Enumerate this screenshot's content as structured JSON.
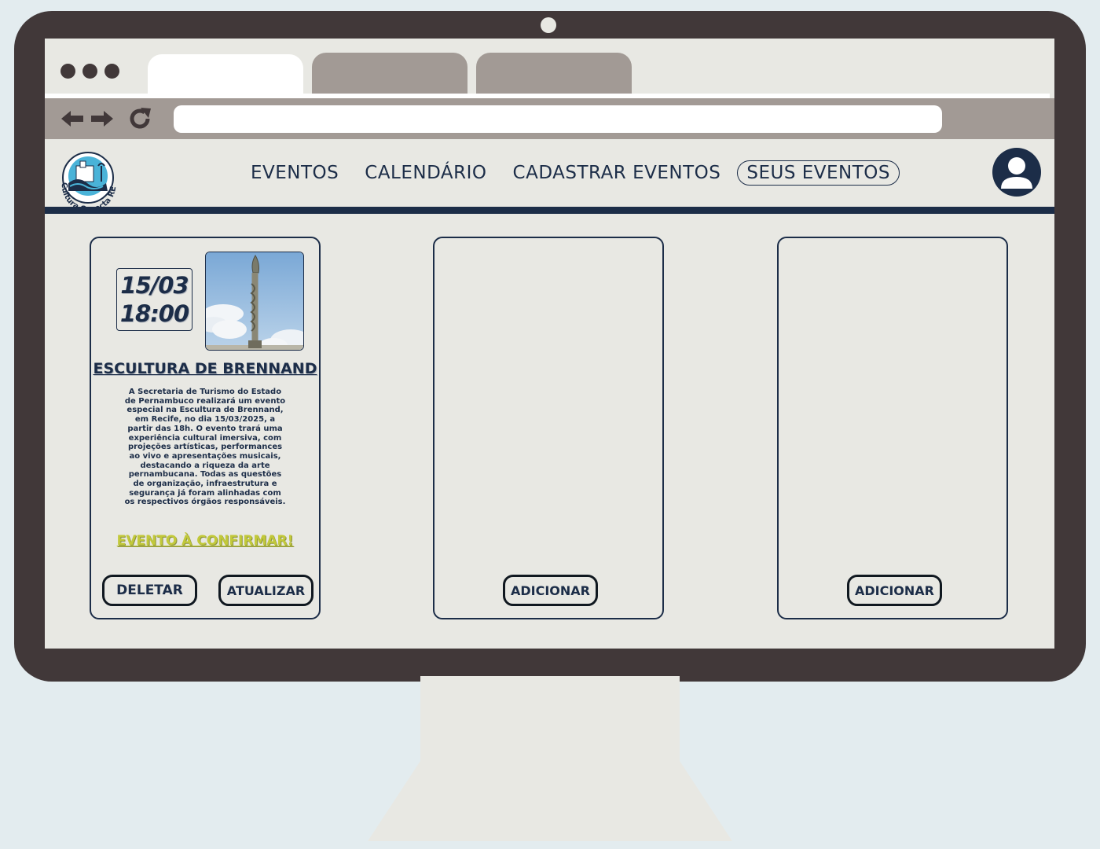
{
  "browser": {
    "tabs": [
      {
        "label": ""
      },
      {
        "label": ""
      },
      {
        "label": ""
      }
    ],
    "address": {
      "value": ""
    }
  },
  "site": {
    "logo_text": "Cultura Conecta REC",
    "nav": [
      {
        "label": "EVENTOS"
      },
      {
        "label": "CALENDÁRIO"
      },
      {
        "label": "CADASTRAR EVENTOS"
      },
      {
        "label": "SEUS EVENTOS",
        "current": true
      }
    ]
  },
  "events": [
    {
      "date": "15/03",
      "time": "18:00",
      "title": "ESCULTURA DE BRENNAND",
      "description": "A Secretaria de Turismo do Estado de Pernambuco realizará um evento especial na Escultura de Brennand, em Recife, no dia 15/03/2025, a partir das 18h. O evento trará uma experiência cultural imersiva, com projeções artísticas, performances ao vivo e apresentações musicais, destacando a riqueza da arte pernambucana. Todas as questões de organização, infraestrutura e segurança já foram alinhadas com os respectivos órgãos responsáveis.",
      "status": "EVENTO À CONFIRMAR!",
      "delete_label": "DELETAR",
      "update_label": "ATUALIZAR"
    }
  ],
  "empty_slots": [
    {
      "add_label": "ADICIONAR"
    },
    {
      "add_label": "ADICIONAR"
    }
  ],
  "colors": {
    "primary": "#1c2d48",
    "status": "#c2c93a",
    "frame": "#413839",
    "screen": "#e8e8e3",
    "toolbar": "#a29a95"
  }
}
